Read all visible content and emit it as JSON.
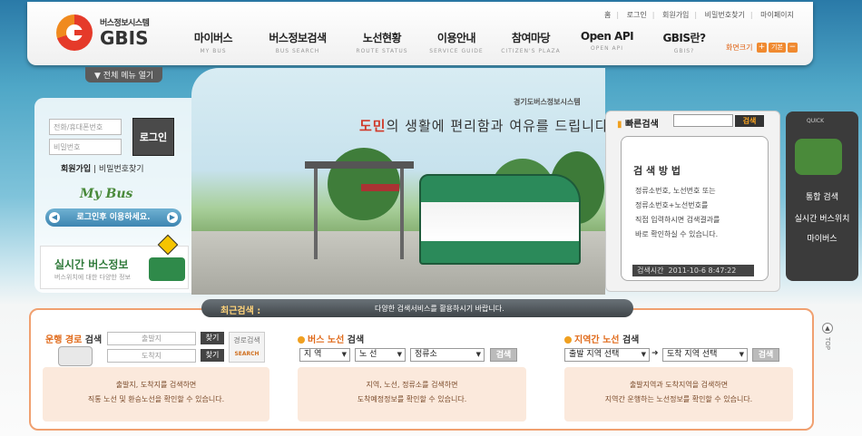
{
  "header": {
    "logo_sub": "버스정보시스템",
    "logo_main": "GBIS",
    "util_links": [
      "홈",
      "로그인",
      "회원가입",
      "비밀번호찾기",
      "마이페이지"
    ],
    "nav": [
      {
        "label": "마이버스",
        "sub": "MY BUS"
      },
      {
        "label": "버스정보검색",
        "sub": "BUS SEARCH"
      },
      {
        "label": "노선현황",
        "sub": "ROUTE STATUS"
      },
      {
        "label": "이용안내",
        "sub": "SERVICE GUIDE"
      },
      {
        "label": "참여마당",
        "sub": "CITIZEN'S PLAZA"
      },
      {
        "label": "Open API",
        "sub": "OPEN API"
      },
      {
        "label": "GBIS란?",
        "sub": "GBIS?"
      }
    ],
    "font_size_label": "화면크기",
    "font_plus": "+",
    "font_default": "기본",
    "font_minus": "−",
    "menu_open": "전체 메뉴 열기"
  },
  "login": {
    "phone_placeholder": "전화/휴대폰번호",
    "password_placeholder": "비밀번호",
    "login_button": "로그인",
    "join": "회원가입",
    "find_password": "비밀번호찾기"
  },
  "mybus": {
    "title": "My Bus",
    "message": "로그인후 이용하세요."
  },
  "realtime": {
    "title": "실시간 버스정보",
    "subtitle": "버스위치에 대한 다양한 정보"
  },
  "hero": {
    "brand": "경기도버스정보시스템",
    "slogan_highlight": "도민",
    "slogan_rest": "의 생활에 편리함과 여유를 드립니다."
  },
  "quick_search": {
    "label": "빠른검색",
    "button": "검색",
    "box_title": "검 색 방 법",
    "lines": [
      "정류소번호, 노선번호 또는",
      "정류소번호+노선번호를",
      "직접 입력하시면 검색결과를",
      "바로 확인하실 수 있습니다."
    ],
    "time_label": "검색시간",
    "time_value": "2011-10-6 8:47:22"
  },
  "quick_menu": {
    "label": "QUICK",
    "items": [
      "통합 검색",
      "실시간 버스위치",
      "마이버스"
    ]
  },
  "recent": {
    "label": "최근검색 :",
    "message": "다양한 검색서비스를 활용하시기 바랍니다."
  },
  "route_search": {
    "title_o": "운행 경로",
    "title_rest": "검색",
    "start_placeholder": "출발지",
    "end_placeholder": "도착지",
    "find": "찾기",
    "route_btn_ko": "경로검색",
    "route_btn_en": "SEARCH",
    "desc1": "출발지, 도착지를 검색하면",
    "desc2": "직통 노선 및 환승노선을 확인할 수 있습니다."
  },
  "bus_route": {
    "title_o": "버스 노선",
    "title_rest": "검색",
    "region": "지 역",
    "route": "노 선",
    "stop": "정류소",
    "button": "검색",
    "desc1": "지역, 노선, 정류소를 검색하면",
    "desc2": "도착예정정보를 확인할 수 있습니다."
  },
  "area_route": {
    "title_o": "지역간 노선",
    "title_rest": "검색",
    "from": "출발 지역 선택",
    "to": "도착 지역 선택",
    "button": "검색",
    "desc1": "출발지역과 도착지역을 검색하면",
    "desc2": "지역간 운행하는 노선정보를 확인할 수 있습니다."
  },
  "top": "TOP"
}
